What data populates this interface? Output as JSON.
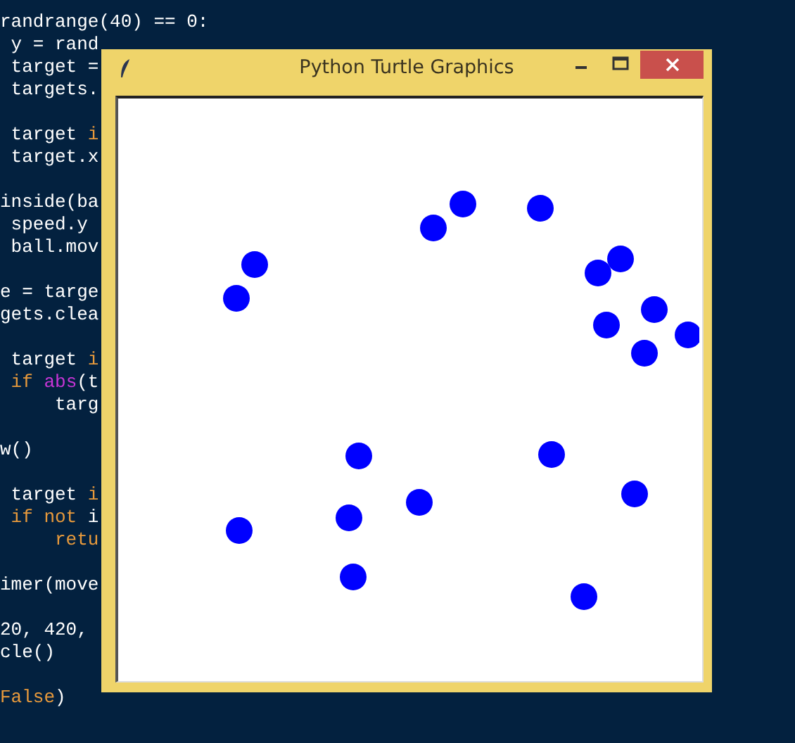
{
  "editor": {
    "blocks": [
      {
        "lines": [
          {
            "tokens": [
              {
                "text": "randrange(40) == 0:",
                "kind": "plain"
              }
            ]
          },
          {
            "tokens": [
              {
                "text": " y = rand",
                "kind": "plain"
              }
            ]
          },
          {
            "tokens": [
              {
                "text": " target =",
                "kind": "plain"
              }
            ]
          },
          {
            "tokens": [
              {
                "text": " targets.",
                "kind": "plain"
              }
            ]
          }
        ]
      },
      {
        "lines": [
          {
            "tokens": [
              {
                "text": " target ",
                "kind": "plain"
              },
              {
                "text": "i",
                "kind": "keyword"
              }
            ]
          },
          {
            "tokens": [
              {
                "text": " target.x",
                "kind": "plain"
              }
            ]
          }
        ]
      },
      {
        "lines": [
          {
            "tokens": [
              {
                "text": "inside(ba",
                "kind": "plain"
              }
            ]
          },
          {
            "tokens": [
              {
                "text": " speed.y",
                "kind": "plain"
              }
            ]
          },
          {
            "tokens": [
              {
                "text": " ball.mov",
                "kind": "plain"
              }
            ]
          }
        ]
      },
      {
        "lines": [
          {
            "tokens": [
              {
                "text": "e = targe",
                "kind": "plain"
              }
            ]
          },
          {
            "tokens": [
              {
                "text": "gets.clea",
                "kind": "plain"
              }
            ]
          }
        ]
      },
      {
        "lines": [
          {
            "tokens": [
              {
                "text": " target ",
                "kind": "plain"
              },
              {
                "text": "i",
                "kind": "keyword"
              }
            ]
          },
          {
            "tokens": [
              {
                "text": " if ",
                "kind": "keyword"
              },
              {
                "text": "abs",
                "kind": "builtin"
              },
              {
                "text": "(t",
                "kind": "plain"
              }
            ]
          },
          {
            "tokens": [
              {
                "text": "     targ",
                "kind": "plain"
              }
            ]
          }
        ]
      },
      {
        "lines": [
          {
            "tokens": [
              {
                "text": "w()",
                "kind": "plain"
              }
            ]
          }
        ]
      },
      {
        "lines": [
          {
            "tokens": [
              {
                "text": " target ",
                "kind": "plain"
              },
              {
                "text": "i",
                "kind": "keyword"
              }
            ]
          },
          {
            "tokens": [
              {
                "text": " if not ",
                "kind": "keyword"
              },
              {
                "text": "i",
                "kind": "plain"
              }
            ]
          },
          {
            "tokens": [
              {
                "text": "     retu",
                "kind": "keyword"
              }
            ]
          }
        ]
      },
      {
        "lines": [
          {
            "tokens": [
              {
                "text": "imer(move",
                "kind": "plain"
              }
            ]
          }
        ]
      },
      {
        "lines": [
          {
            "tokens": [
              {
                "text": "20, 420,",
                "kind": "plain"
              }
            ]
          },
          {
            "tokens": [
              {
                "text": "cle()",
                "kind": "plain"
              }
            ]
          }
        ]
      },
      {
        "lines": [
          {
            "tokens": [
              {
                "text": "False",
                "kind": "keyword"
              },
              {
                "text": ")",
                "kind": "plain"
              }
            ]
          }
        ]
      }
    ]
  },
  "window": {
    "title": "Python Turtle Graphics"
  }
}
